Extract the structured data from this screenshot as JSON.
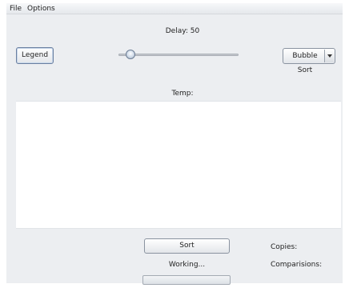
{
  "menu": {
    "items": [
      "File",
      "Options"
    ]
  },
  "controls": {
    "delay_label": "Delay: 50",
    "delay_value": 50,
    "delay_min": 0,
    "delay_max": 500,
    "legend_label": "Legend",
    "algorithm_selected": "Bubble Sort"
  },
  "display": {
    "temp_label": "Temp:"
  },
  "footer": {
    "sort_label": "Sort",
    "working_label": "Working...",
    "copies_label": "Copies:",
    "comparisons_label": "Comparisions:",
    "progress_fraction": 0
  },
  "icons": {
    "dropdown": "chevron-down-icon"
  }
}
